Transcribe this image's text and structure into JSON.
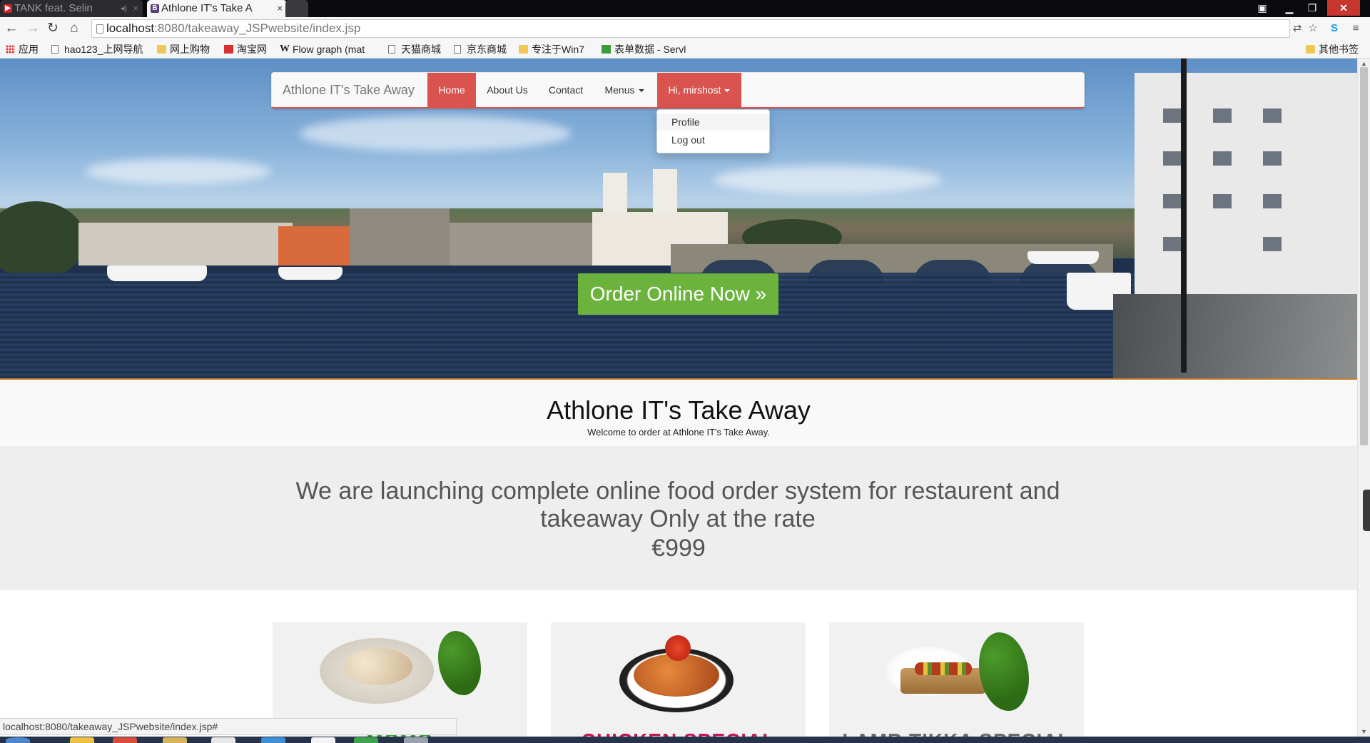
{
  "browser": {
    "tabs": [
      {
        "title": "TANK feat. Selin",
        "favicon": "youtube-icon",
        "active": false
      },
      {
        "title": "Athlone IT's Take A",
        "favicon": "bootstrap-icon",
        "active": true
      }
    ],
    "close_glyph": "×",
    "audio_glyph": "◂)",
    "url_host": "localhost",
    "url_rest": ":8080/takeaway_JSPwebsite/index.jsp",
    "bookmarks": [
      {
        "label": "应用",
        "icon": "apps-icon"
      },
      {
        "label": "hao123_上网导航",
        "icon": "page-icon"
      },
      {
        "label": "网上购物",
        "icon": "folder-icon"
      },
      {
        "label": "淘宝网",
        "icon": "taobao-icon"
      },
      {
        "label": "Flow graph (mat",
        "icon": "wikipedia-icon"
      },
      {
        "label": "天猫商城",
        "icon": "page-icon"
      },
      {
        "label": "京东商城",
        "icon": "page-icon"
      },
      {
        "label": "专注于Win7",
        "icon": "folder-icon"
      },
      {
        "label": "表单数据 - Servl",
        "icon": "excel-icon"
      }
    ],
    "other_bookmarks": "其他书签",
    "status_url": "localhost:8080/takeaway_JSPwebsite/index.jsp#"
  },
  "navbar": {
    "brand": "Athlone IT's Take Away",
    "items": [
      {
        "label": "Home",
        "active": true
      },
      {
        "label": "About Us",
        "active": false
      },
      {
        "label": "Contact",
        "active": false
      },
      {
        "label": "Menus",
        "active": false,
        "dropdown": true
      },
      {
        "label": "Hi, mirshost",
        "active": true,
        "dropdown": true
      }
    ],
    "user_menu": [
      "Profile",
      "Log out"
    ],
    "accent_color": "#d9534f"
  },
  "hero": {
    "cta_label": "Order Online Now »",
    "cta_color": "#6cb33e"
  },
  "intro": {
    "title": "Athlone IT's Take Away",
    "subtitle": "Welcome to order at Athlone IT's Take Away."
  },
  "launch": {
    "headline": "We are launching complete online food order system for restaurent and takeaway Only at the rate",
    "price": "€999"
  },
  "cards": [
    {
      "title": "MOMO",
      "image": "momo-dumplings-plate",
      "title_color": "#3c9b3c"
    },
    {
      "title": "CHICKEN SPECIAL",
      "image": "grilled-chicken-plate",
      "title_color": "#c2185b"
    },
    {
      "title": "LAMB TIKKA SPECIAL",
      "image": "kebab-skewers-board",
      "title_color": "#6b6b6b"
    }
  ]
}
